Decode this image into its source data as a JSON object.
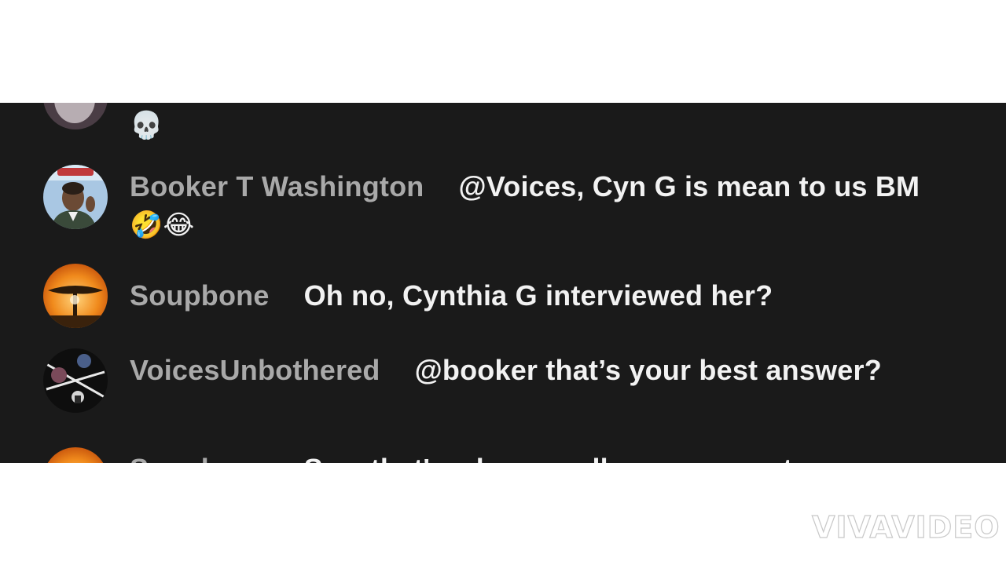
{
  "messages": [
    {
      "username": "",
      "text": "",
      "emoji": "💀"
    },
    {
      "username": "Booker T Washington",
      "text": "@Voices, Cyn G is mean to us BM",
      "emoji": "🤣😂"
    },
    {
      "username": "Soupbone",
      "text": "Oh no, Cynthia G interviewed her?",
      "emoji": ""
    },
    {
      "username": "VoicesUnbothered",
      "text": "@booker that’s your best answer?",
      "emoji": ""
    },
    {
      "username": "Soupbone",
      "text": "See, that's why you all were wrong to",
      "emoji": ""
    }
  ],
  "watermark": "VIVAVIDEO",
  "colors": {
    "panel_bg": "#1a1a1a",
    "username": "#a9a9a9",
    "message": "#f2f2f2"
  }
}
